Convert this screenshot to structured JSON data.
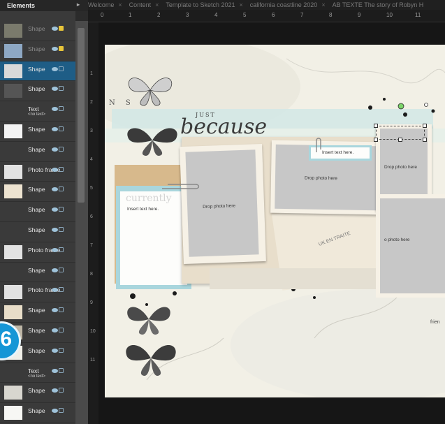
{
  "tabs": [
    {
      "label": "Welcome"
    },
    {
      "label": "Content"
    },
    {
      "label": "Template to Sketch 2021"
    },
    {
      "label": "california coastline 2020"
    },
    {
      "label": "AB TEXTE The story of Robyn H"
    }
  ],
  "tab_close_glyph": "×",
  "panel": {
    "title": "Elements",
    "collapse_glyph": "▸",
    "rows": [
      {
        "label": "Shape",
        "sub": "",
        "selected": false,
        "dim": true,
        "lock": "gold"
      },
      {
        "label": "Shape",
        "sub": "",
        "selected": false,
        "dim": true,
        "lock": "gold"
      },
      {
        "label": "Shape",
        "sub": "",
        "selected": true,
        "dim": false,
        "lock": ""
      },
      {
        "label": "Shape",
        "sub": "",
        "selected": false,
        "dim": false,
        "lock": ""
      },
      {
        "label": "Text",
        "sub": "<no text>",
        "selected": false,
        "dim": false,
        "lock": ""
      },
      {
        "label": "Shape",
        "sub": "",
        "selected": false,
        "dim": false,
        "lock": ""
      },
      {
        "label": "Shape",
        "sub": "",
        "selected": false,
        "dim": false,
        "lock": ""
      },
      {
        "label": "Photo frame",
        "sub": "",
        "selected": false,
        "dim": false,
        "lock": ""
      },
      {
        "label": "Shape",
        "sub": "",
        "selected": false,
        "dim": false,
        "lock": ""
      },
      {
        "label": "Shape",
        "sub": "",
        "selected": false,
        "dim": false,
        "lock": ""
      },
      {
        "label": "Shape",
        "sub": "",
        "selected": false,
        "dim": false,
        "lock": ""
      },
      {
        "label": "Photo frame",
        "sub": "",
        "selected": false,
        "dim": false,
        "lock": ""
      },
      {
        "label": "Shape",
        "sub": "",
        "selected": false,
        "dim": false,
        "lock": ""
      },
      {
        "label": "Photo frame",
        "sub": "",
        "selected": false,
        "dim": false,
        "lock": ""
      },
      {
        "label": "Shape",
        "sub": "",
        "selected": false,
        "dim": false,
        "lock": ""
      },
      {
        "label": "Shape",
        "sub": "",
        "selected": false,
        "dim": false,
        "lock": ""
      },
      {
        "label": "Shape",
        "sub": "",
        "selected": false,
        "dim": false,
        "lock": ""
      },
      {
        "label": "Text",
        "sub": "<no text>",
        "selected": false,
        "dim": false,
        "lock": ""
      },
      {
        "label": "Shape",
        "sub": "",
        "selected": false,
        "dim": false,
        "lock": ""
      },
      {
        "label": "Shape",
        "sub": "",
        "selected": false,
        "dim": false,
        "lock": ""
      }
    ]
  },
  "step_badge": "6",
  "ruler_top": [
    "1",
    "2",
    "3",
    "4",
    "5",
    "6",
    "7",
    "8",
    "9",
    "10",
    "11"
  ],
  "ruler_left": [
    "1",
    "2",
    "3",
    "4",
    "5",
    "6",
    "7",
    "8",
    "9",
    "10",
    "11"
  ],
  "canvas": {
    "title_small": "JUST",
    "title_script": "because",
    "journal_word": "currently",
    "insert_text_left": "Insert text here.",
    "insert_text_top": "Insert text here.",
    "drop_photo_left": "Drop photo here",
    "drop_photo_center": "Drop photo here",
    "drop_photo_right_top": "Drop photo here",
    "drop_photo_right_bottom": "o photo here",
    "stamp_letters": "N S",
    "ledger_text": "UK EN TRAITE",
    "friends_fragment": "frien"
  },
  "colors": {
    "selected_row": "#1e5d86",
    "accent_teal": "#a9d6dd",
    "badge": "#1596d6",
    "handle_green": "#7bd36a"
  }
}
